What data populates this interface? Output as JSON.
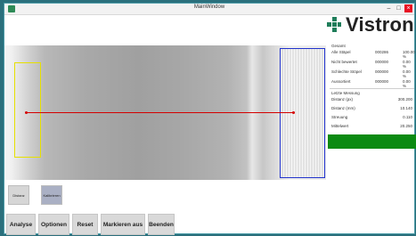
{
  "window": {
    "title": "MainWindow"
  },
  "controls": {
    "minimize": "–",
    "maximize": "□",
    "close": "×"
  },
  "logo": {
    "text": "Vistron",
    "color": "#1f7d5a"
  },
  "stats": {
    "header": "Gesamt",
    "rows": [
      {
        "label": "Alle Stäpel",
        "count": "000286",
        "percent": "100.00 %"
      },
      {
        "label": "Nicht bewertet",
        "count": "000000",
        "percent": "0.00 %"
      },
      {
        "label": "Schlechte Stöpel",
        "count": "000000",
        "percent": "0.00 %"
      },
      {
        "label": "Aussortiert",
        "count": "000000",
        "percent": "0.00 %"
      }
    ],
    "measure_header": "Letzte Messung",
    "measures": [
      {
        "label": "Distanz (px)",
        "value": "300.200"
      },
      {
        "label": "Distanz (mm)",
        "value": "10.140"
      },
      {
        "label": "Streuung",
        "value": "0.110"
      },
      {
        "label": "Mittelwert",
        "value": "20.250"
      }
    ],
    "status_color": "#0b8a12"
  },
  "mode_buttons": [
    {
      "label": "Distanz",
      "active": false
    },
    {
      "label": "Kalibrieren",
      "active": true
    }
  ],
  "actions": {
    "analyse": "Analyse",
    "optionen": "Optionen",
    "reset": "Reset",
    "markieren": "Markieren aus",
    "beenden": "Beenden"
  }
}
